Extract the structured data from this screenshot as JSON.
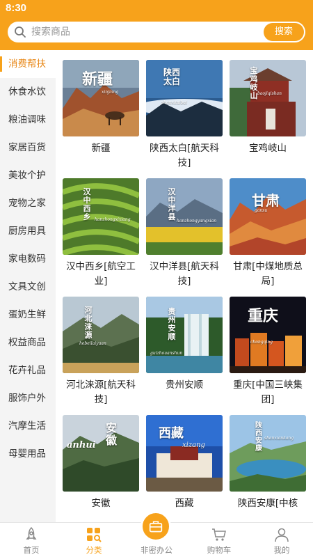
{
  "status": {
    "time": "8:30"
  },
  "search": {
    "placeholder": "搜索商品",
    "button": "搜索"
  },
  "sidebar": {
    "items": [
      "消费帮扶",
      "休食水饮",
      "粮油调味",
      "家居百货",
      "美妆个护",
      "宠物之家",
      "厨房用具",
      "家电数码",
      "文具文创",
      "蛋奶生鲜",
      "权益商品",
      "花卉礼品",
      "服饰户外",
      "汽摩生活",
      "母婴用品"
    ]
  },
  "tiles": [
    {
      "label": "新疆",
      "title": "新疆",
      "sub": "xinjiang"
    },
    {
      "label": "陕西太白[航天科技]",
      "title": "陕西太白",
      "sub": "shanxitaibai"
    },
    {
      "label": "宝鸡岐山",
      "title": "宝鸡岐山",
      "sub": "baojiqishan"
    },
    {
      "label": "汉中西乡[航空工业]",
      "title": "汉中西乡",
      "sub": "hanzhongxixiang"
    },
    {
      "label": "汉中洋县[航天科技]",
      "title": "汉中洋县",
      "sub": "hanzhongyangxian"
    },
    {
      "label": "甘肃[中煤地质总局]",
      "title": "甘肃",
      "sub": "gansu"
    },
    {
      "label": "河北涞源[航天科技]",
      "title": "河北涞源",
      "sub": "hebeilaiyuan"
    },
    {
      "label": "贵州安顺",
      "title": "贵州安顺",
      "sub": "guizhouanshun"
    },
    {
      "label": "重庆[中国三峡集团]",
      "title": "重庆",
      "sub": "chongqing"
    },
    {
      "label": "安徽",
      "title": "安徽",
      "sub": "anhui"
    },
    {
      "label": "西藏",
      "title": "西藏",
      "sub": "xizang"
    },
    {
      "label": "陕西安康[中核",
      "title": "陕西安康",
      "sub": "shanxiankang"
    }
  ],
  "nav": [
    {
      "label": "首页",
      "icon": "rocket-icon"
    },
    {
      "label": "分类",
      "icon": "category-icon"
    },
    {
      "label": "非密办公",
      "icon": "briefcase-icon"
    },
    {
      "label": "购物车",
      "icon": "cart-icon"
    },
    {
      "label": "我的",
      "icon": "user-icon"
    }
  ],
  "colors": {
    "accent": "#f7a21b",
    "active_text": "#e8891a"
  }
}
